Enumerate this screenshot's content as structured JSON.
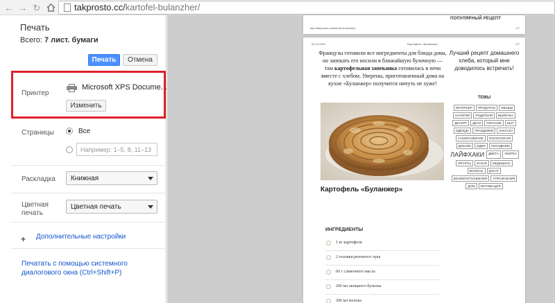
{
  "browser": {
    "url_host": "takprosto.cc/",
    "url_path": "kartofel-bulanzher/"
  },
  "print_panel": {
    "title": "Печать",
    "total_prefix": "Всего: ",
    "total_value": "7 лист. бумаги",
    "print_button": "Печать",
    "cancel_button": "Отмена",
    "printer_label": "Принтер",
    "printer_name": "Microsoft XPS Docume...",
    "change_button": "Изменить",
    "pages_label": "Страницы",
    "pages_all": "Все",
    "pages_placeholder": "Например: 1–5, 8, 11–13",
    "layout_label": "Раскладка",
    "layout_value": "Книжная",
    "color_label": "Цветная печать",
    "color_value": "Цветная печать",
    "more_settings": "Дополнительные настройки",
    "system_dialog": "Печатать с помощью системного диалогового окна (Ctrl+Shift+P)"
  },
  "preview": {
    "page1": {
      "popular": "ПОПУЛЯРНЫЙ РЕЦЕПТ",
      "url": "http://takprosto.cc/kartofel-bulanzher/",
      "page_num": "1/7"
    },
    "page2": {
      "date": "22.10.2015",
      "header_title": "Картофель «Буланжер»",
      "page_num": "2/7",
      "intro_1": "Французы готовили все ингредиенты для блюда дома, но запекать его носили в ближайшую булочную — там ",
      "intro_bold": "картофельная запеканка",
      "intro_2": " готовилась в печи вместе с хлебом. Уверены, приготовленный дома на кухне «Буланжер» получится ничуть не хуже!",
      "recipe_title": "Картофель «Буланжер»",
      "ingredients_title": "ИНГРЕДИЕНТЫ",
      "ingredients": [
        "1 кг картофеля",
        "2 головки репчатого лука",
        "60 г сливочного масла",
        "200 мл овощного бульона",
        "200 мл молока"
      ],
      "side_best": "Лучший рецепт домашнего хлеба, который мне доводилось встречать!",
      "themes_title": "ТЕМЫ",
      "tags": [
        "ИНТЕРЬЕР",
        "ПРОДУКТЫ",
        "ОВОЩИ",
        "НАПИТКИ",
        "РОДИТЕЛИ",
        "ВЫПЕЧКА",
        "ДЕСЕРТ",
        "ДЕТИ",
        "ПИТАНИЕ",
        "БЫТ",
        "ОДЕЖДА",
        "ПРАЗДНИКИ",
        "ЗАКУСКА",
        "САМОРАЗВИТИЕ",
        "ПСИХОЛОГИЯ",
        "ДИЗАЙН",
        "ИДЕИ",
        "ПОХУДЕНИЕ",
        "ЛАЙФХАКИ",
        "ДИЕТА",
        "УБОРКА",
        "ФРУКТЫ",
        "КУХНЯ",
        "МЕДИЦИНА",
        "ВОЛОСЫ",
        "ДОСУГ",
        "ВЗАИМООТНОШЕНИЯ",
        "УПРАЖНЕНИЯ",
        "ДОМ",
        "МОТИВАЦИЯ"
      ]
    }
  },
  "colors": {
    "highlight": "#e0202a",
    "print_button": "#4d90fe",
    "link": "#1155cc",
    "preview_bg": "#cdcdcd"
  }
}
